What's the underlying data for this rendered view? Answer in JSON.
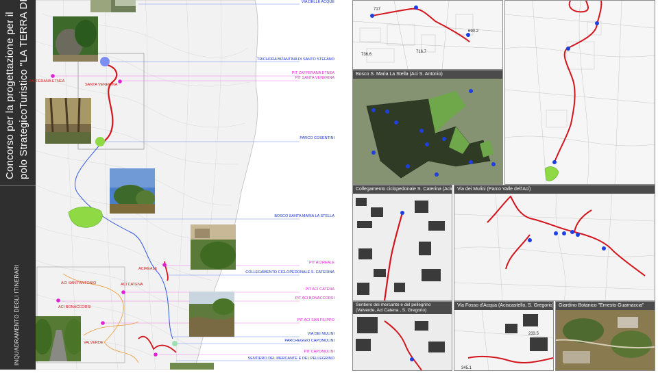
{
  "sidebar": {
    "title_line1": "Concorso per la progettazione per il",
    "title_line2": "polo StrategicoTuristico \"LA TERRA DEI C",
    "section_label": "INQUADRAMENTO DEGLI ITINERARI"
  },
  "main_map": {
    "itinerary_labels": [
      "VIA DELLE ACQUE",
      "TRICHORA BIZANTINA DI SANTO STEFANO",
      "PARCO COSENTINI",
      "BOSCO SANTA MARIA LA STELLA",
      "COLLEGAMENTO CICLOPEDONALE S. CATERINA",
      "VIA DEI MULINI",
      "PARCHEGGIO CAPOMULINI",
      "SENTIERO DEL MERCANTE E DEL PELLEGRINO"
    ],
    "pit_labels": [
      "PIT ZAFFERANA ETNEA",
      "PIT SANTA VENERINA",
      "PIT ACIREALE",
      "PIT ACI CATENA",
      "PIT ACI BONACCORSI",
      "PIT ACI SAN FILIPPO",
      "PIT CAPOMULINI"
    ],
    "town_labels": [
      "ZAFFERANA ETNEA",
      "SANTA VENERINA",
      "ACIREALE",
      "ACI SANT'ANTONIO",
      "ACI CATENA",
      "ACI BONACCORSI",
      "VALVERDE"
    ]
  },
  "panels": {
    "via_delle_acque": {
      "spot_heights": [
        "717",
        "690.2",
        "736.6",
        "716.7"
      ]
    },
    "bosco": {
      "title": "Bosco S. Maria La Stella (Aci S. Antonio)"
    },
    "collegamento": {
      "title": "Collegamento ciclopedonale S. Caterina (Acireale)"
    },
    "mulini": {
      "title": "Via dei Mulini (Parco Valle dell'Aci)"
    },
    "sentiero": {
      "title_line1": "Sentiero  del mercante e del pellegrino",
      "title_line2": "(Valverde, Aci Catena , S. Gregorio)"
    },
    "fosso": {
      "title": "Via Fosso d'Acqua (Aciscastello, S. Gregorio)",
      "spot_heights": [
        "233.5",
        "345.1"
      ]
    },
    "giardino": {
      "title": "Giardino Botanico \"Ernesto Guarnaccia\""
    }
  },
  "colors": {
    "route_red": "#d4141c",
    "poi_blue": "#1e3fe0",
    "pit_magenta": "#e21fd6",
    "park_green": "#8fd944",
    "sidebar_dark": "#2f2f2f",
    "panel_header": "#4b4b4b"
  }
}
